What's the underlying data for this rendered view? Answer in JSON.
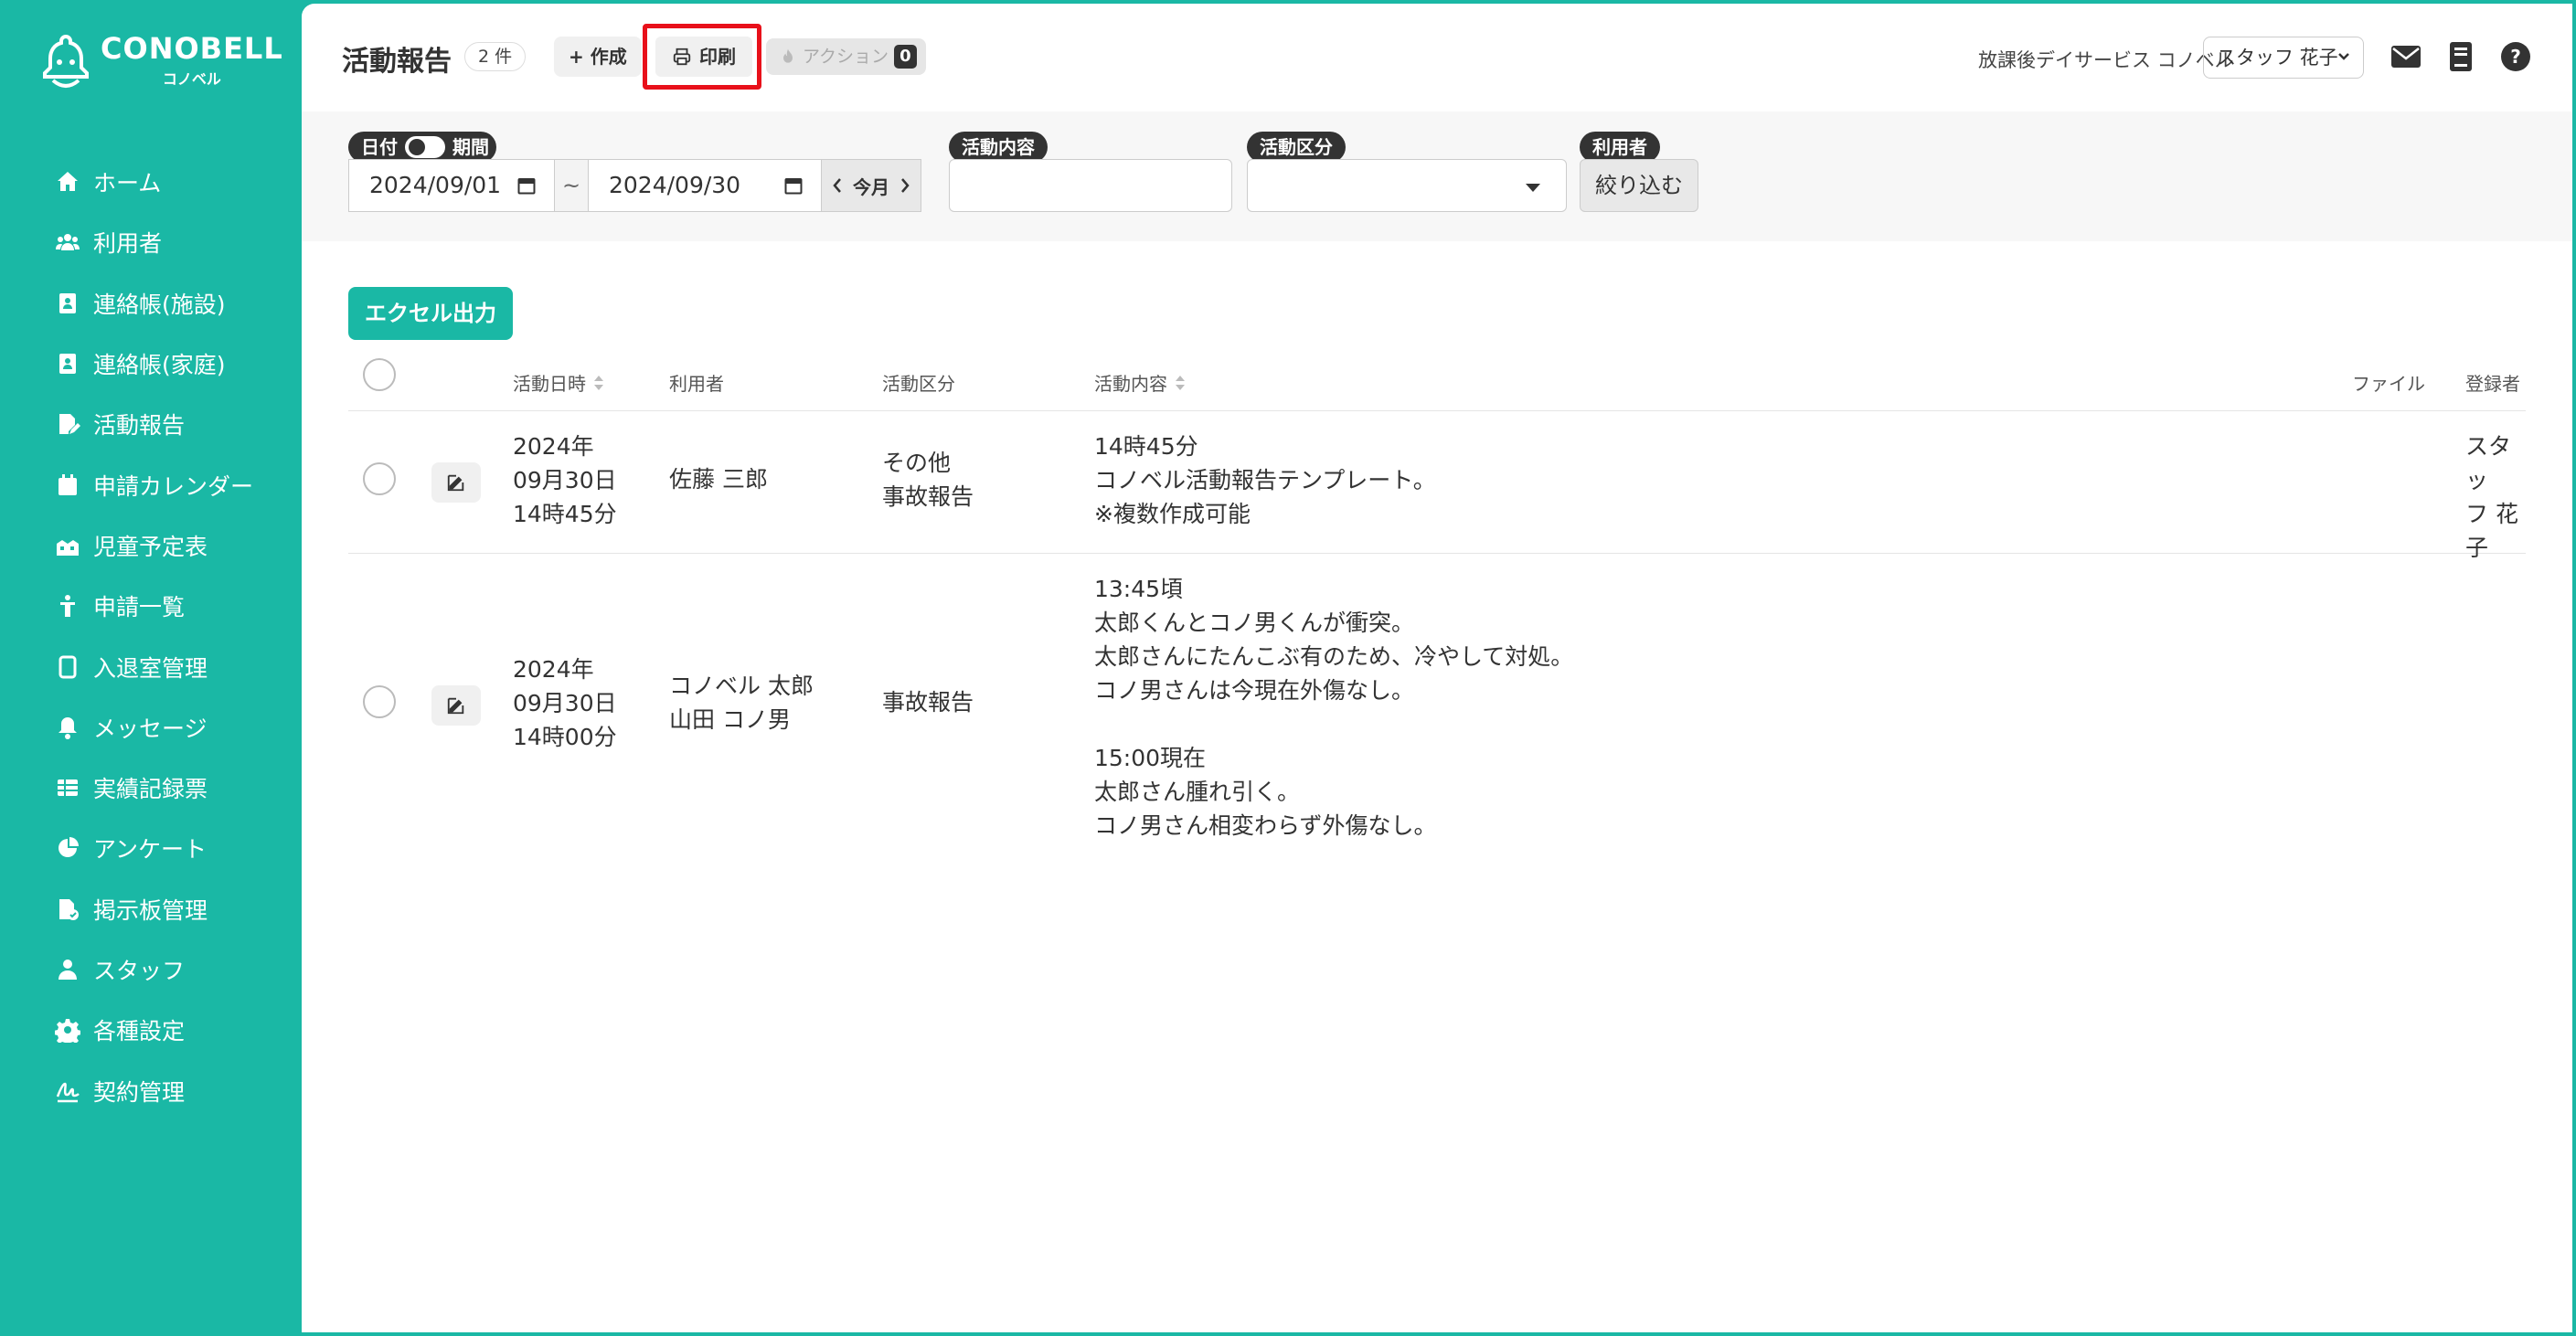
{
  "logo": {
    "main": "CONOBELL",
    "sub": "コノベル"
  },
  "sidebar": {
    "items": [
      {
        "label": "ホーム",
        "icon": "home-icon"
      },
      {
        "label": "利用者",
        "icon": "users-icon"
      },
      {
        "label": "連絡帳(施設)",
        "icon": "contact-book-icon"
      },
      {
        "label": "連絡帳(家庭)",
        "icon": "contact-book-icon"
      },
      {
        "label": "活動報告",
        "icon": "report-edit-icon"
      },
      {
        "label": "申請カレンダー",
        "icon": "calendar-icon"
      },
      {
        "label": "児童予定表",
        "icon": "schedule-icon"
      },
      {
        "label": "申請一覧",
        "icon": "person-icon"
      },
      {
        "label": "入退室管理",
        "icon": "tablet-icon"
      },
      {
        "label": "メッセージ",
        "icon": "bell-icon"
      },
      {
        "label": "実績記録票",
        "icon": "table-icon"
      },
      {
        "label": "アンケート",
        "icon": "pie-chart-icon"
      },
      {
        "label": "掲示板管理",
        "icon": "file-check-icon"
      },
      {
        "label": "スタッフ",
        "icon": "staff-icon"
      },
      {
        "label": "各種設定",
        "icon": "gear-icon"
      },
      {
        "label": "契約管理",
        "icon": "signature-icon"
      }
    ]
  },
  "header": {
    "title": "活動報告",
    "count": "2 件",
    "create_label": "+ 作成",
    "print_label": "印刷",
    "action_label": "アクション",
    "action_count": "0",
    "facility": "放課後デイサービス コノベル",
    "staff": "スタッフ 花子"
  },
  "filters": {
    "date_tag_left": "日付",
    "date_tag_right": "期間",
    "date_from": "2024/09/01",
    "date_to": "2024/09/30",
    "tilde": "~",
    "this_month": "今月",
    "content_tag": "活動内容",
    "category_tag": "活動区分",
    "user_tag": "利用者",
    "filter_button": "絞り込む"
  },
  "excel_label": "エクセル出力",
  "table": {
    "headers": {
      "datetime": "活動日時",
      "user": "利用者",
      "category": "活動区分",
      "content": "活動内容",
      "file": "ファイル",
      "registrant": "登録者"
    },
    "rows": [
      {
        "datetime": [
          "2024年",
          "09月30日",
          "14時45分"
        ],
        "users": [
          "佐藤 三郎"
        ],
        "category": [
          "その他",
          "事故報告"
        ],
        "content": [
          "14時45分",
          "コノベル活動報告テンプレート。",
          "※複数作成可能"
        ],
        "registrant": [
          "スタッ",
          "フ 花",
          "子"
        ]
      },
      {
        "datetime": [
          "2024年",
          "09月30日",
          "14時00分"
        ],
        "users": [
          "コノベル 太郎",
          "山田 コノ男"
        ],
        "category": [
          "事故報告"
        ],
        "content": [
          "13:45頃",
          "太郎くんとコノ男くんが衝突。",
          "太郎さんにたんこぶ有のため、冷やして対処。",
          "コノ男さんは今現在外傷なし。",
          "",
          "15:00現在",
          "太郎さん腫れ引く。",
          "コノ男さん相変わらず外傷なし。"
        ],
        "registrant": []
      }
    ]
  },
  "colors": {
    "brand": "#1ab8a5",
    "highlight": "#e8101a",
    "dark": "#333333"
  }
}
